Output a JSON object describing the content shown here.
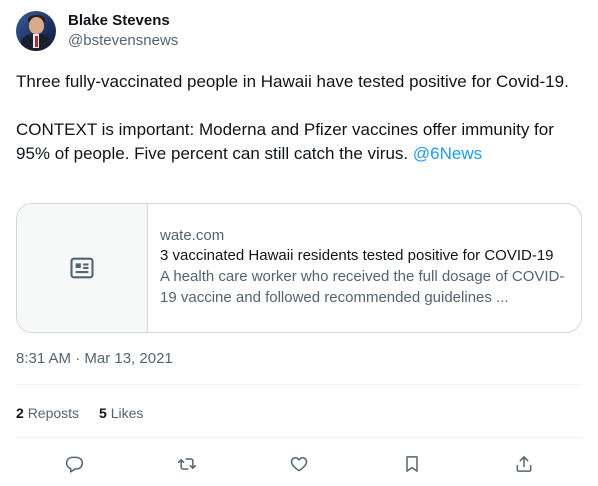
{
  "author": {
    "display_name": "Blake Stevens",
    "handle": "@bstevensnews",
    "avatar_icon": "user-avatar"
  },
  "tweet": {
    "text_line1": "Three fully-vaccinated people in Hawaii have tested positive for Covid-19.",
    "text_line2": "CONTEXT is important: Moderna and Pfizer vaccines offer immunity for 95% of people. Five percent can still catch the virus. ",
    "mention": "@6News"
  },
  "card": {
    "icon": "article-icon",
    "domain": "wate.com",
    "title": "3 vaccinated Hawaii residents tested positive for COVID-19",
    "description": "A health care worker who received the full dosage of COVID-19 vaccine and followed recommended guidelines ..."
  },
  "timestamp": "8:31 AM · Mar 13, 2021",
  "stats": {
    "reposts_count": "2",
    "reposts_label": "Reposts",
    "likes_count": "5",
    "likes_label": "Likes"
  },
  "colors": {
    "link": "#1d9bf0",
    "secondary_text": "#536471",
    "border": "#cfd9de",
    "icon": "#536471"
  },
  "actions": [
    "reply-icon",
    "repost-icon",
    "like-icon",
    "bookmark-icon",
    "share-icon"
  ]
}
